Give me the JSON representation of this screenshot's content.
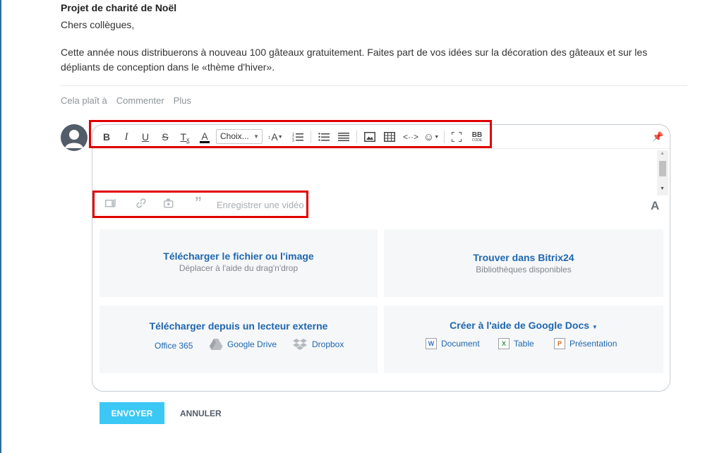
{
  "post": {
    "title": "Projet de charité de Noël",
    "greeting": "Chers collègues,",
    "body": "Cette année nous distribuerons à nouveau 100 gâteaux gratuitement. Faites part de vos idées sur la décoration des gâteaux et sur les dépliants de conception dans le «thème d'hiver»."
  },
  "actions": {
    "like": "Cela plaît à",
    "comment": "Commenter",
    "more": "Plus"
  },
  "toolbar": {
    "bold": "B",
    "italic": "I",
    "underline": "U",
    "strike": "S",
    "clear_format": "T",
    "font_color": "A",
    "font_select": "Choix...",
    "font_size": "A",
    "bbcode_top": "BB",
    "bbcode_bottom": "CODE"
  },
  "attach_bar": {
    "record_video": "Enregistrer une vidéo",
    "format_icon": "A"
  },
  "panels": {
    "upload": {
      "title": "Télécharger le fichier ou l'image",
      "subtitle": "Déplacer à l'aide du drag'n'drop"
    },
    "bitrix": {
      "title": "Trouver dans Bitrix24",
      "subtitle": "Bibliothèques disponibles"
    },
    "external": {
      "title": "Télécharger depuis un lecteur externe",
      "office": "Office 365",
      "gdrive": "Google Drive",
      "dropbox": "Dropbox"
    },
    "gdocs": {
      "title": "Créer à l'aide de Google Docs",
      "document": "Document",
      "table": "Table",
      "presentation": "Présentation"
    }
  },
  "buttons": {
    "send": "ENVOYER",
    "cancel": "ANNULER"
  },
  "colors": {
    "accent": "#3bc8f5",
    "link": "#2067b0",
    "highlight": "#e00000"
  }
}
